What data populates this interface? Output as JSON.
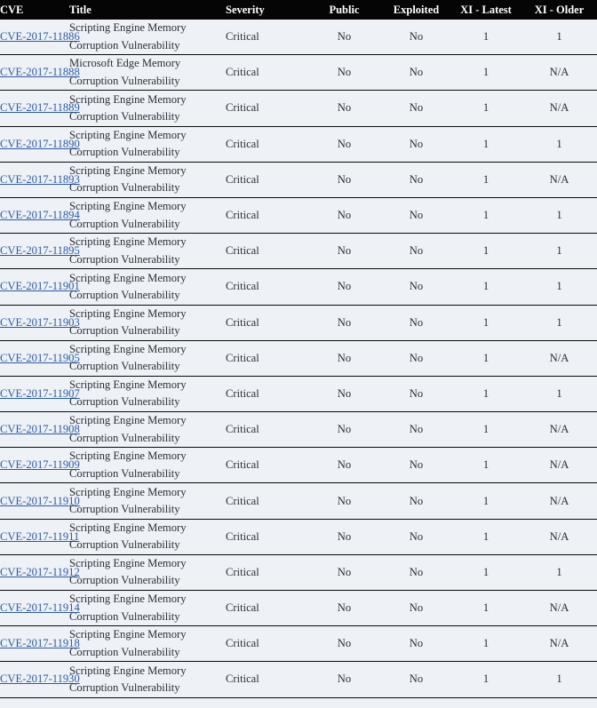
{
  "table": {
    "columns": [
      {
        "key": "cve",
        "label": "CVE"
      },
      {
        "key": "title",
        "label": "Title"
      },
      {
        "key": "severity",
        "label": "Severity"
      },
      {
        "key": "public",
        "label": "Public"
      },
      {
        "key": "exploited",
        "label": "Exploited"
      },
      {
        "key": "xi_latest",
        "label": "XI - Latest"
      },
      {
        "key": "xi_older",
        "label": "XI - Older"
      }
    ],
    "colors": {
      "header_background": "#050505",
      "header_text": "#ffffff",
      "row_background": "#eef1f5",
      "severity_critical_background": "#fbcdb0",
      "link": "#2b5ca8",
      "row_border": "#0b0b0b",
      "text": "#2b2f36"
    },
    "rows": [
      {
        "cve": "CVE-2017-11886",
        "title": "Scripting Engine Memory Corruption Vulnerability",
        "severity": "Critical",
        "public": "No",
        "exploited": "No",
        "xi_latest": "1",
        "xi_older": "1"
      },
      {
        "cve": "CVE-2017-11888",
        "title": "Microsoft Edge Memory Corruption Vulnerability",
        "severity": "Critical",
        "public": "No",
        "exploited": "No",
        "xi_latest": "1",
        "xi_older": "N/A"
      },
      {
        "cve": "CVE-2017-11889",
        "title": "Scripting Engine Memory Corruption Vulnerability",
        "severity": "Critical",
        "public": "No",
        "exploited": "No",
        "xi_latest": "1",
        "xi_older": "N/A"
      },
      {
        "cve": "CVE-2017-11890",
        "title": "Scripting Engine Memory Corruption Vulnerability",
        "severity": "Critical",
        "public": "No",
        "exploited": "No",
        "xi_latest": "1",
        "xi_older": "1"
      },
      {
        "cve": "CVE-2017-11893",
        "title": "Scripting Engine Memory Corruption Vulnerability",
        "severity": "Critical",
        "public": "No",
        "exploited": "No",
        "xi_latest": "1",
        "xi_older": "N/A"
      },
      {
        "cve": "CVE-2017-11894",
        "title": "Scripting Engine Memory Corruption Vulnerability",
        "severity": "Critical",
        "public": "No",
        "exploited": "No",
        "xi_latest": "1",
        "xi_older": "1"
      },
      {
        "cve": "CVE-2017-11895",
        "title": "Scripting Engine Memory Corruption Vulnerability",
        "severity": "Critical",
        "public": "No",
        "exploited": "No",
        "xi_latest": "1",
        "xi_older": "1"
      },
      {
        "cve": "CVE-2017-11901",
        "title": "Scripting Engine Memory Corruption Vulnerability",
        "severity": "Critical",
        "public": "No",
        "exploited": "No",
        "xi_latest": "1",
        "xi_older": "1"
      },
      {
        "cve": "CVE-2017-11903",
        "title": "Scripting Engine Memory Corruption Vulnerability",
        "severity": "Critical",
        "public": "No",
        "exploited": "No",
        "xi_latest": "1",
        "xi_older": "1"
      },
      {
        "cve": "CVE-2017-11905",
        "title": "Scripting Engine Memory Corruption Vulnerability",
        "severity": "Critical",
        "public": "No",
        "exploited": "No",
        "xi_latest": "1",
        "xi_older": "N/A"
      },
      {
        "cve": "CVE-2017-11907",
        "title": "Scripting Engine Memory Corruption Vulnerability",
        "severity": "Critical",
        "public": "No",
        "exploited": "No",
        "xi_latest": "1",
        "xi_older": "1"
      },
      {
        "cve": "CVE-2017-11908",
        "title": "Scripting Engine Memory Corruption Vulnerability",
        "severity": "Critical",
        "public": "No",
        "exploited": "No",
        "xi_latest": "1",
        "xi_older": "N/A"
      },
      {
        "cve": "CVE-2017-11909",
        "title": "Scripting Engine Memory Corruption Vulnerability",
        "severity": "Critical",
        "public": "No",
        "exploited": "No",
        "xi_latest": "1",
        "xi_older": "N/A"
      },
      {
        "cve": "CVE-2017-11910",
        "title": "Scripting Engine Memory Corruption Vulnerability",
        "severity": "Critical",
        "public": "No",
        "exploited": "No",
        "xi_latest": "1",
        "xi_older": "N/A"
      },
      {
        "cve": "CVE-2017-11911",
        "title": "Scripting Engine Memory Corruption Vulnerability",
        "severity": "Critical",
        "public": "No",
        "exploited": "No",
        "xi_latest": "1",
        "xi_older": "N/A"
      },
      {
        "cve": "CVE-2017-11912",
        "title": "Scripting Engine Memory Corruption Vulnerability",
        "severity": "Critical",
        "public": "No",
        "exploited": "No",
        "xi_latest": "1",
        "xi_older": "1"
      },
      {
        "cve": "CVE-2017-11914",
        "title": "Scripting Engine Memory Corruption Vulnerability",
        "severity": "Critical",
        "public": "No",
        "exploited": "No",
        "xi_latest": "1",
        "xi_older": "N/A"
      },
      {
        "cve": "CVE-2017-11918",
        "title": "Scripting Engine Memory Corruption Vulnerability",
        "severity": "Critical",
        "public": "No",
        "exploited": "No",
        "xi_latest": "1",
        "xi_older": "N/A"
      },
      {
        "cve": "CVE-2017-11930",
        "title": "Scripting Engine Memory Corruption Vulnerability",
        "severity": "Critical",
        "public": "No",
        "exploited": "No",
        "xi_latest": "1",
        "xi_older": "1"
      }
    ]
  }
}
